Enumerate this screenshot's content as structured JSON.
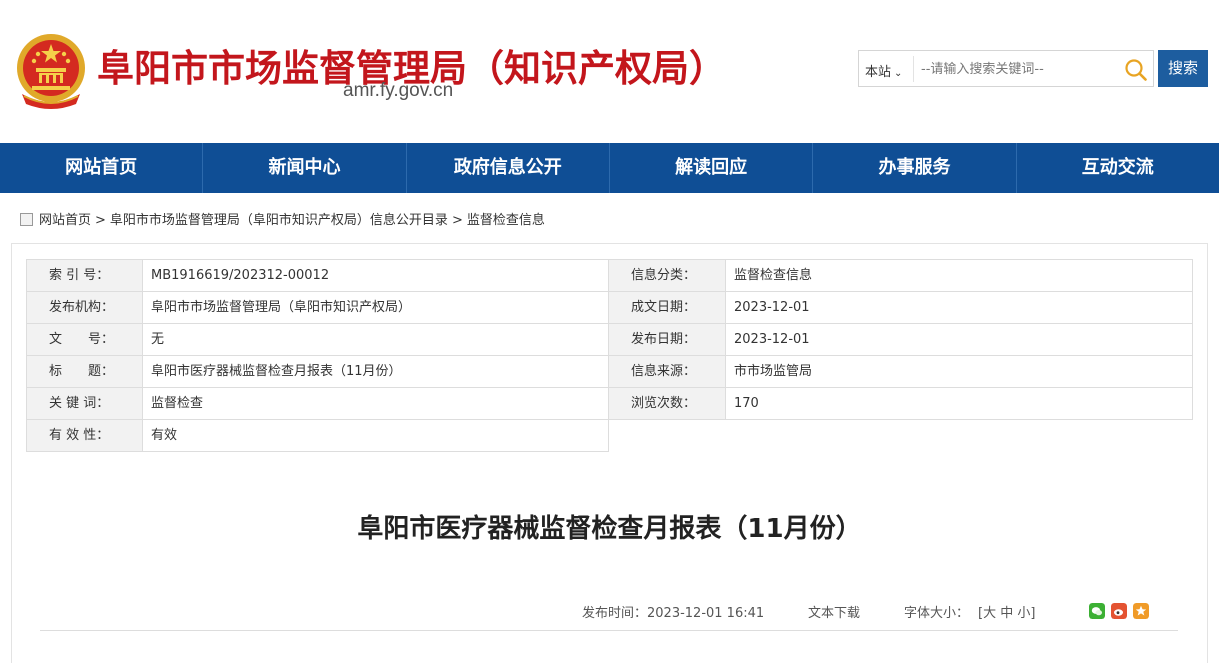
{
  "header": {
    "title": "阜阳市市场监督管理局（知识产权局）",
    "domain": "amr.fy.gov.cn",
    "emblem_icon": "national-emblem-icon",
    "brand_color": "#c3161c"
  },
  "search": {
    "scope": "本站",
    "placeholder": "--请输入搜索关键词--",
    "button": "搜索"
  },
  "nav": {
    "items": [
      "网站首页",
      "新闻中心",
      "政府信息公开",
      "解读回应",
      "办事服务",
      "互动交流"
    ],
    "bg_color": "#0f4e95"
  },
  "breadcrumb": {
    "items": [
      "网站首页",
      "阜阳市市场监督管理局（阜阳市知识产权局）信息公开目录",
      "监督检查信息"
    ],
    "sep": ">"
  },
  "meta": {
    "rows": [
      {
        "l_label": "索 引 号：",
        "l_value": "MB1916619/202312-00012",
        "r_label": "信息分类：",
        "r_value": "监督检查信息"
      },
      {
        "l_label": "发布机构：",
        "l_value": "阜阳市市场监督管理局（阜阳市知识产权局）",
        "r_label": "成文日期：",
        "r_value": "2023-12-01"
      },
      {
        "l_label": "文　　号：",
        "l_value": "无",
        "r_label": "发布日期：",
        "r_value": "2023-12-01"
      },
      {
        "l_label": "标　　题：",
        "l_value": "阜阳市医疗器械监督检查月报表（11月份）",
        "r_label": "信息来源：",
        "r_value": "市市场监管局"
      },
      {
        "l_label": "关 键 词：",
        "l_value": "监督检查",
        "r_label": "浏览次数：",
        "r_value": "170"
      },
      {
        "l_label": "有 效 性：",
        "l_value": "有效"
      }
    ]
  },
  "article": {
    "title": "阜阳市医疗器械监督检查月报表（11月份）",
    "publish_time": "发布时间：2023-12-01 16:41",
    "download": "文本下载",
    "font_size_label": "字体大小：",
    "font_size_options": "[大 中 小]"
  }
}
